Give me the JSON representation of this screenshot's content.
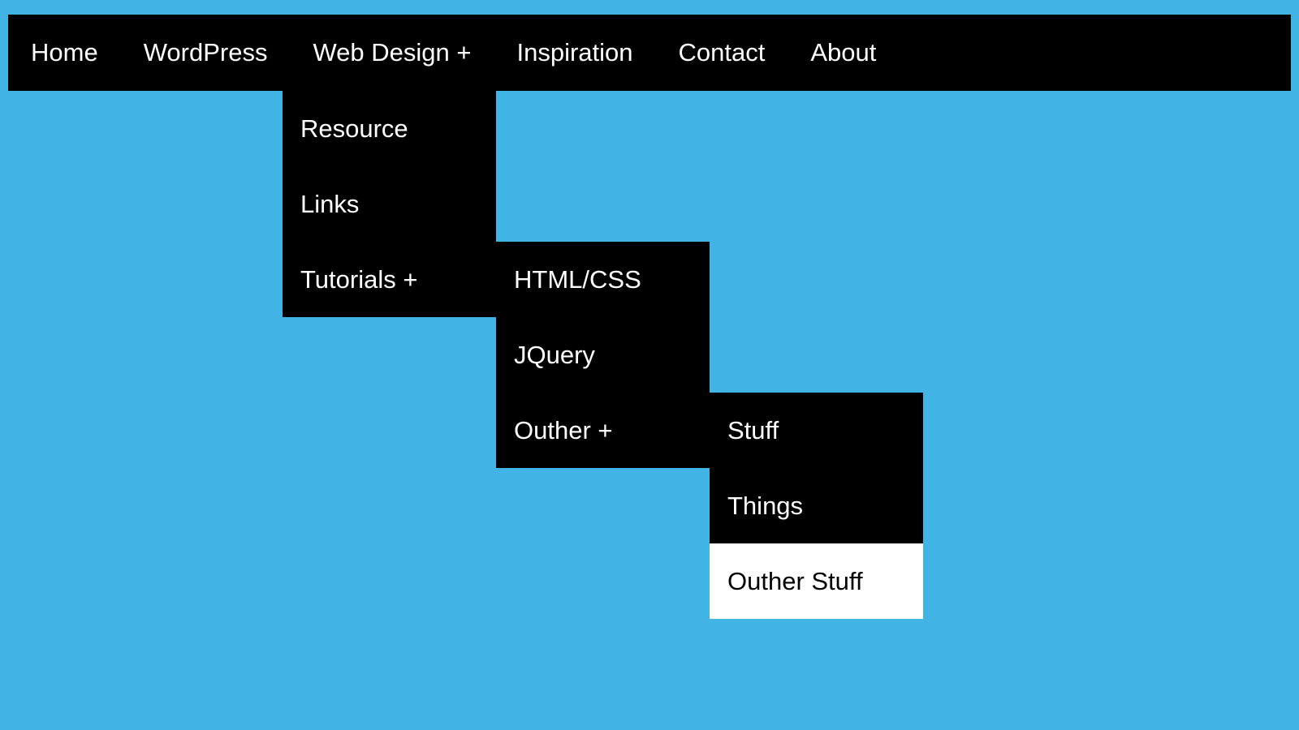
{
  "nav": {
    "items": [
      {
        "label": "Home"
      },
      {
        "label": "WordPress"
      },
      {
        "label": "Web Design +"
      },
      {
        "label": "Inspiration"
      },
      {
        "label": "Contact"
      },
      {
        "label": "About"
      }
    ]
  },
  "submenu_web_design": {
    "items": [
      {
        "label": "Resource"
      },
      {
        "label": "Links"
      },
      {
        "label": "Tutorials +"
      }
    ]
  },
  "submenu_tutorials": {
    "items": [
      {
        "label": "HTML/CSS"
      },
      {
        "label": "JQuery"
      },
      {
        "label": "Outher +"
      }
    ]
  },
  "submenu_outher": {
    "items": [
      {
        "label": "Stuff"
      },
      {
        "label": "Things"
      },
      {
        "label": "Outher Stuff"
      }
    ]
  }
}
